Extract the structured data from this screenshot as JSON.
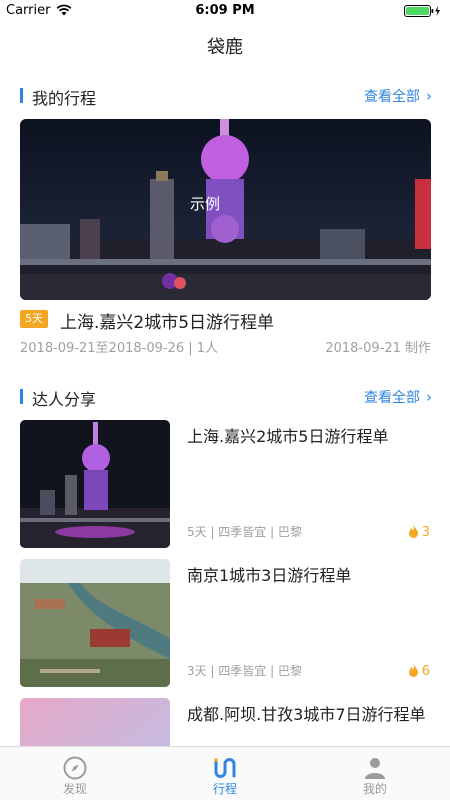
{
  "status_bar": {
    "carrier": "Carrier",
    "time": "6:09 PM"
  },
  "nav": {
    "title": "袋鹿"
  },
  "my_trips": {
    "title": "我的行程",
    "view_all": "查看全部",
    "hero_label": "示例",
    "trip": {
      "days": "5天",
      "title": "上海.嘉兴2城市5日游行程单",
      "dates": "2018-09-21至2018-09-26 | 1人",
      "created": "2018-09-21 制作"
    }
  },
  "expert_share": {
    "title": "达人分享",
    "view_all": "查看全部",
    "cards": [
      {
        "title": "上海.嘉兴2城市5日游行程单",
        "meta": "5天 | 四季皆宜 | 巴黎",
        "hot": "3"
      },
      {
        "title": "南京1城市3日游行程单",
        "meta": "3天 | 四季皆宜 | 巴黎",
        "hot": "6"
      },
      {
        "title": "成都.阿坝.甘孜3城市7日游行程单",
        "meta": "",
        "hot": ""
      }
    ]
  },
  "tabs": [
    {
      "label": "发现",
      "icon": "compass-icon",
      "active": false
    },
    {
      "label": "行程",
      "icon": "itinerary-icon",
      "active": true
    },
    {
      "label": "我的",
      "icon": "person-icon",
      "active": false
    }
  ],
  "colors": {
    "accent": "#2f86e0",
    "badge": "#f4a623",
    "muted": "#a0a0a0"
  }
}
